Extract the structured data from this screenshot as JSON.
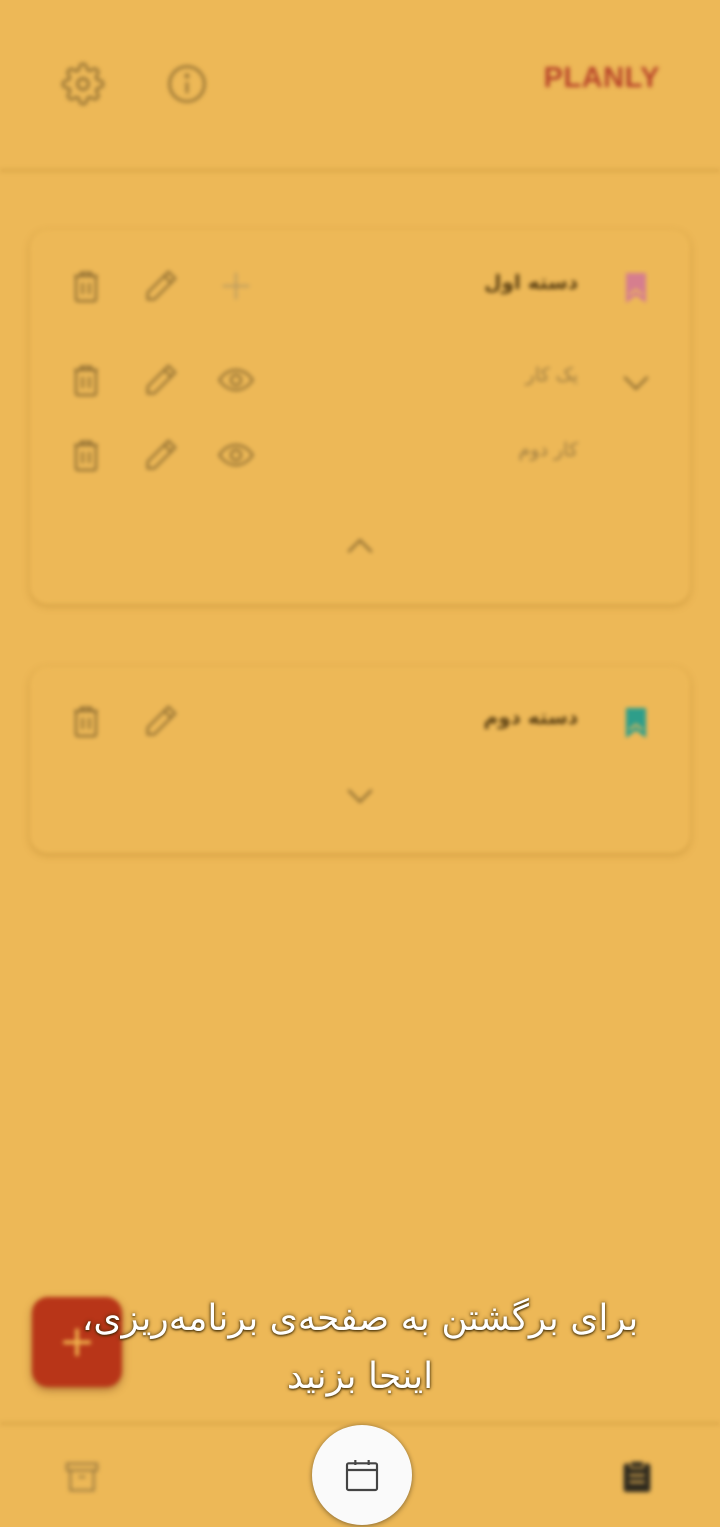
{
  "header": {
    "brand": "PLANLY",
    "settings_icon": "gear-icon",
    "info_icon": "info-icon"
  },
  "categories": [
    {
      "title": "دسته اول",
      "bookmark_color": "#D67E8E",
      "expanded": true,
      "tasks": [
        {
          "title": "یک کار"
        },
        {
          "title": "کار دوم"
        }
      ]
    },
    {
      "title": "دسته دوم",
      "bookmark_color": "#2E9E8A",
      "expanded": false,
      "tasks": []
    }
  ],
  "fab": {
    "label": "+"
  },
  "tutorial_hint": {
    "line1": "برای برگشتن به صفحه‌ی برنامه‌ریزی،",
    "line2": "اینجا بزنید"
  },
  "colors": {
    "background": "#EDB857",
    "brand": "#B8452A",
    "fab": "#B83518",
    "calendar_button": "#FAFAFA"
  }
}
